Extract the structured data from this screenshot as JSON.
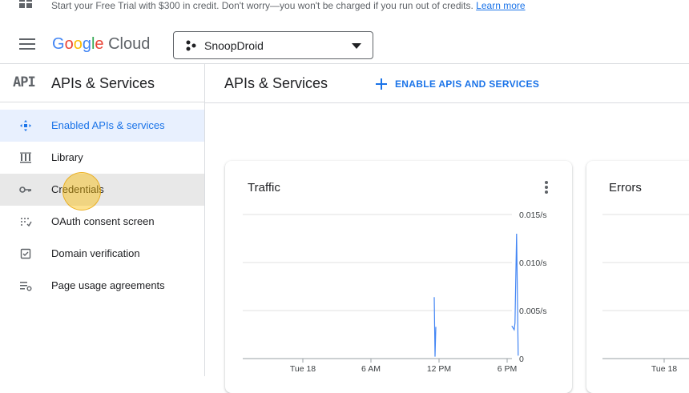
{
  "banner": {
    "message": "Start your Free Trial with $300 in credit. Don't worry—you won't be charged if you run out of credits.",
    "learn_more": "Learn more"
  },
  "header": {
    "logo_google": [
      "G",
      "o",
      "o",
      "g",
      "l",
      "e"
    ],
    "logo_cloud": "Cloud",
    "project_name": "SnoopDroid"
  },
  "sidebar": {
    "badge": "API",
    "title": "APIs & Services",
    "items": [
      {
        "label": "Enabled APIs & services",
        "icon": "diamond-arrows-icon",
        "active": true
      },
      {
        "label": "Library",
        "icon": "library-icon"
      },
      {
        "label": "Credentials",
        "icon": "key-icon",
        "hover": true
      },
      {
        "label": "OAuth consent screen",
        "icon": "dots-grid-icon"
      },
      {
        "label": "Domain verification",
        "icon": "checkbox-icon"
      },
      {
        "label": "Page usage agreements",
        "icon": "settings-list-icon"
      }
    ]
  },
  "main": {
    "title": "APIs & Services",
    "enable_button": "ENABLE APIS AND SERVICES"
  },
  "cards": {
    "traffic_title": "Traffic",
    "errors_title": "Errors",
    "errors_x_label": "Tue 18"
  },
  "colors": {
    "accent": "#1a73e8",
    "line": "#4285f4",
    "grid": "#e0e0e0"
  },
  "chart_data": {
    "type": "line",
    "title": "Traffic",
    "xlabel": "",
    "ylabel": "",
    "x_ticks": [
      "Tue 18",
      "6 AM",
      "12 PM",
      "6 PM"
    ],
    "y_ticks": [
      "0.015/s",
      "0.010/s",
      "0.005/s",
      "0"
    ],
    "ylim": [
      0,
      0.015
    ],
    "grid": true,
    "series": [
      {
        "values": [
          {
            "x": "12 PM",
            "y": 0.0064
          },
          {
            "x": "12 PM",
            "y": 0.0002
          },
          {
            "x": "12 PM",
            "y": 0.0033
          },
          {
            "x": "5 PM",
            "y": 0.0034
          },
          {
            "x": "5 PM",
            "y": 0.003
          },
          {
            "x": "5 PM",
            "y": 0.0037
          },
          {
            "x": "5 PM",
            "y": 0.013
          },
          {
            "x": "5 PM",
            "y": 0.0003
          }
        ]
      }
    ]
  }
}
